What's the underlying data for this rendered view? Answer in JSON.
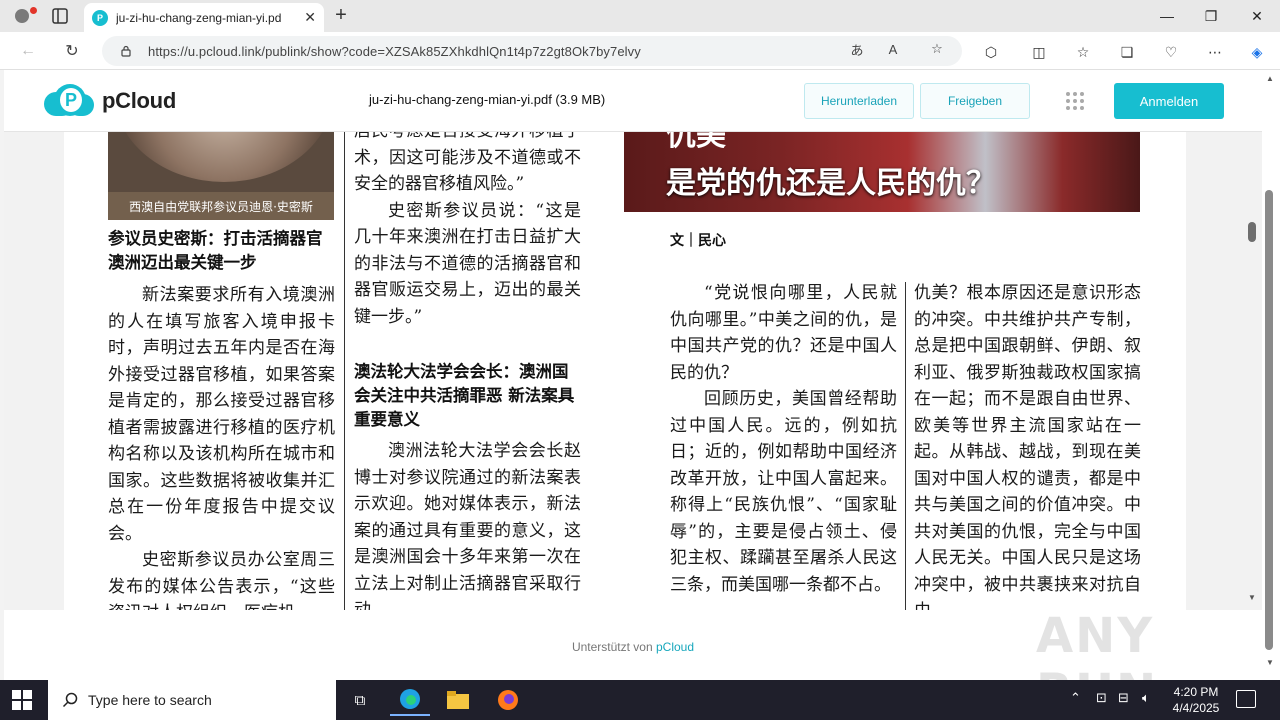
{
  "browser": {
    "tab_title": "ju-zi-hu-chang-zeng-mian-yi.pd",
    "url": "https://u.pcloud.link/publink/show?code=XZSAk85ZXhkdhlQn1t4p7z2gt8Ok7by7elvy"
  },
  "pcloud": {
    "brand": "pCloud",
    "filename": "ju-zi-hu-chang-zeng-mian-yi.pdf (3.9 MB)",
    "download_label": "Herunterladen",
    "share_label": "Freigeben",
    "login_label": "Anmelden",
    "footer_prefix": "Unterstützt von",
    "footer_brand": "pCloud"
  },
  "document": {
    "photo_caption": "西澳自由党联邦参议员迪恩·史密斯",
    "col1": {
      "heading": "参议员史密斯：打击活摘器官 澳洲迈出最关键一步",
      "p1": "新法案要求所有入境澳洲的人在填写旅客入境申报卡时，声明过去五年内是否在海外接受过器官移植，如果答案是肯定的，那么接受过器官移植者需披露进行移植的医疗机构名称以及该机构所在城市和国家。这些数据将被收集并汇总在一份年度报告中提交议会。",
      "p2": "史密斯参议员办公室周三发布的媒体公告表示，“这些资讯对人权组织、医疗机"
    },
    "col2": {
      "p0": "居民考虑是否接受海外移植手术，因这可能涉及不道德或不安全的器官移植风险。”",
      "p1": "史密斯参议员说：“这是几十年来澳洲在打击日益扩大的非法与不道德的活摘器官和器官贩运交易上，迈出的最关键一步。”",
      "heading": "澳法轮大法学会会长：澳洲国会关注中共活摘罪恶 新法案具重要意义",
      "p2": "澳洲法轮大法学会会长赵博士对参议院通过的新法案表示欢迎。她对媒体表示，新法案的通过具有重要的意义，这是澳洲国会十多年来第一次在立法上对制止活摘器官采取行动"
    },
    "banner_line1": "仇美",
    "banner_line2": "是党的仇还是人民的仇？",
    "byline": "文｜民心",
    "col3": {
      "p1": "“党说恨向哪里，人民就仇向哪里。”中美之间的仇，是中国共产党的仇？还是中国人民的仇？",
      "p2": "回顾历史，美国曾经帮助过中国人民。远的，例如抗日；近的，例如帮助中国经济改革开放，让中国人富起来。 称得上“民族仇恨”、“国家耻辱”的，主要是侵占领土、侵犯主权、蹂躏甚至屠杀人民这三条，而美国哪一条都不占。"
    },
    "col4": {
      "p1": "仇美？根本原因还是意识形态的冲突。中共维护共产专制，总是把中国跟朝鲜、伊朗、叙利亚、俄罗斯独裁政权国家搞在一起；而不是跟自由世界、欧美等世界主流国家站在一起。从韩战、越战，到现在美国对中国人权的谴责，都是中共与美国之间的价值冲突。中共对美国的仇恨，完全与中国人民无关。中国人民只是这场冲突中，被中共裹挟来对抗自由"
    }
  },
  "taskbar": {
    "search_placeholder": "Type here to search",
    "time": "4:20 PM",
    "date": "4/4/2025"
  },
  "watermark": "ANY RUN",
  "colors": {
    "accent": "#17bed0"
  }
}
